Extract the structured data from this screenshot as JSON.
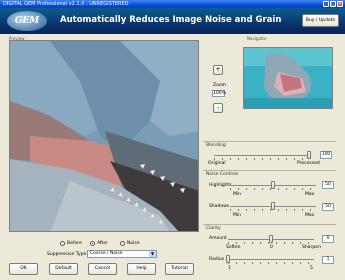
{
  "window": {
    "title": "DIGITAL GEM Professional  v2.1.0 : UNREGISTERED"
  },
  "header": {
    "logo_text": "GEM",
    "slogan": "Automatically Reduces Image Noise and Grain",
    "buy_update_label": "Buy / Update"
  },
  "preview": {
    "label": "Preview"
  },
  "navigator": {
    "label": "Navigator",
    "zoom_in_label": "+",
    "zoom_out_label": "-",
    "zoom_label": "Zoom",
    "zoom_value": "100%"
  },
  "view_mode": {
    "options": [
      "Before",
      "After",
      "Noise"
    ],
    "selected": "After"
  },
  "suppression": {
    "label": "Suppression Type",
    "value": "Coarse / Noise"
  },
  "buttons": {
    "ok": "OK",
    "default": "Default",
    "cancel": "Cancel",
    "help": "Help",
    "tutorial": "Tutorial"
  },
  "blending": {
    "group_label": "Blending",
    "min_label": "Original",
    "max_label": "Processed",
    "value": "100",
    "level": 1.0
  },
  "noise_controls": {
    "group_label": "Noise Controls",
    "highlights": {
      "label": "Highlights",
      "min_label": "Min",
      "max_label": "Max",
      "value": "50",
      "level": 0.5
    },
    "shadows": {
      "label": "Shadows",
      "min_label": "Min",
      "max_label": "Max",
      "value": "50",
      "level": 0.5
    }
  },
  "clarity": {
    "group_label": "Clarity",
    "amount": {
      "label": "Amount",
      "min_label": "Soften",
      "mid_label": "0",
      "max_label": "Sharpen",
      "value": "0",
      "level": 0.5
    },
    "radius": {
      "label": "Radius",
      "min_label": "1",
      "max_label": "5",
      "value": "1",
      "level": 0.0
    }
  },
  "colors": {
    "titlebar": "#0a4fd6",
    "banner": "#0a2f6a",
    "face": "#ece9d8"
  },
  "icons": [
    "minimize-icon",
    "maximize-icon",
    "close-icon",
    "dropdown-arrow-icon"
  ]
}
